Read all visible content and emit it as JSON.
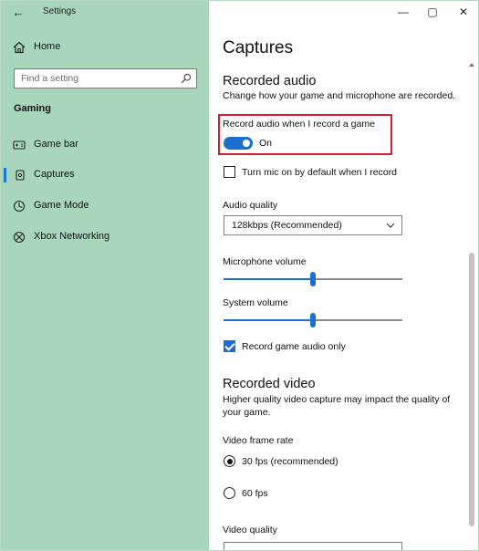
{
  "window": {
    "title": "Settings",
    "controls": {
      "minimize": "—",
      "maximize": "▢",
      "close": "✕"
    }
  },
  "sidebar": {
    "home": "Home",
    "search_placeholder": "Find a setting",
    "group": "Gaming",
    "items": [
      {
        "label": "Game bar",
        "icon": "game-bar-icon"
      },
      {
        "label": "Captures",
        "icon": "captures-icon",
        "active": true
      },
      {
        "label": "Game Mode",
        "icon": "game-mode-icon"
      },
      {
        "label": "Xbox Networking",
        "icon": "xbox-icon"
      }
    ]
  },
  "main": {
    "title": "Captures",
    "recorded_audio": {
      "heading": "Recorded audio",
      "description": "Change how your game and microphone are recorded.",
      "record_toggle": {
        "label": "Record audio when I record a game",
        "state": "On"
      },
      "mic_checkbox": "Turn mic on by default when I record",
      "quality_label": "Audio quality",
      "quality_value": "128kbps (Recommended)",
      "mic_volume_label": "Microphone volume",
      "mic_volume_level": 0.5,
      "system_volume_label": "System volume",
      "system_volume_level": 0.5,
      "game_audio_checkbox": "Record game audio only"
    },
    "recorded_video": {
      "heading": "Recorded video",
      "description": "Higher quality video capture may impact the quality of your game.",
      "frame_rate_label": "Video frame rate",
      "fps_30": "30 fps (recommended)",
      "fps_60": "60 fps",
      "quality_label": "Video quality"
    }
  },
  "colors": {
    "sidebar": "#a9d5bc",
    "accent": "#1a6fd1",
    "highlight": "#d81e2c"
  }
}
